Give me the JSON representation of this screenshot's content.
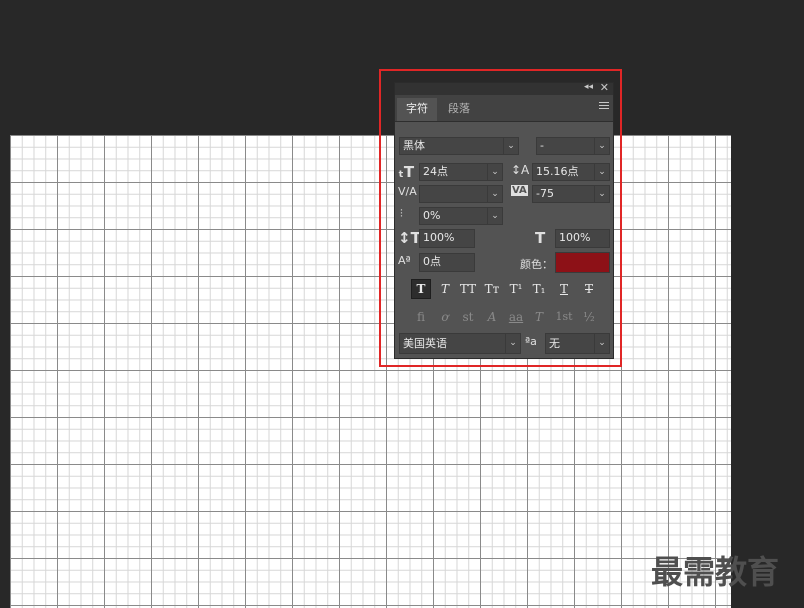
{
  "panel": {
    "tabs": [
      {
        "label": "字符",
        "active": true
      },
      {
        "label": "段落",
        "active": false
      }
    ],
    "font_family": "黑体",
    "font_style": "-",
    "font_size": "24点",
    "leading": "15.16点",
    "kerning": "",
    "tracking": "-75",
    "tsume": "0%",
    "vertical_scale": "100%",
    "horizontal_scale": "100%",
    "baseline_shift": "0点",
    "color_label": "颜色：",
    "color_value": "#8d1117",
    "style_buttons": [
      "T",
      "T",
      "TT",
      "Tт",
      "T¹",
      "T₁",
      "T",
      "T"
    ],
    "opentype_buttons": [
      "ﬁ",
      "ơ",
      "st",
      "A",
      "aa",
      "T",
      "1st",
      "½"
    ],
    "language": "美国英语",
    "antialias_label": "ªa",
    "antialias": "无"
  },
  "watermark": "最需教育"
}
